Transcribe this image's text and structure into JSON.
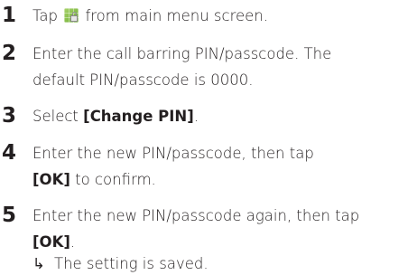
{
  "steps": [
    {
      "number": "1",
      "text_before": "Tap",
      "icon": "call-barring-lock-icon",
      "text_after": "from main menu screen."
    },
    {
      "number": "2",
      "line1": "Enter the call barring PIN/passcode. The",
      "line2": "default PIN/passcode is 0000."
    },
    {
      "number": "3",
      "text_before": "Select",
      "bold": "[Change PIN]",
      "text_after": "."
    },
    {
      "number": "4",
      "line1": "Enter the new PIN/passcode, then tap",
      "bold": "[OK]",
      "line2_after": "to confirm."
    },
    {
      "number": "5",
      "line1": "Enter the new PIN/passcode again, then tap",
      "bold": "[OK]",
      "line2_after": ".",
      "result_arrow": "↳",
      "result_text": "The setting is saved."
    }
  ]
}
